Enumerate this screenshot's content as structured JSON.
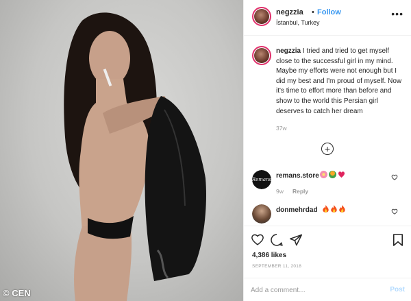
{
  "photo": {
    "credit": "© CEN"
  },
  "post": {
    "username": "negzzia",
    "separator": "•",
    "follow_label": "Follow",
    "location": "İstanbul, Turkey",
    "more_icon": "more-dots-icon"
  },
  "caption": {
    "username": "negzzia",
    "text": "I tried and tried to get myself close to the successful girl in my mind. Maybe my efforts were not enough but I did my best and I'm proud of myself. Now it's time to effort more than before and show to the world this Persian girl deserves to catch her dream",
    "time": "37w"
  },
  "load_more_icon": "plus-circle-icon",
  "comments": [
    {
      "username": "remans.store",
      "avatar_text": "Remans",
      "time": "9w",
      "reply_label": "Reply"
    },
    {
      "username": "donmehrdad"
    }
  ],
  "actions": {
    "likes": "4,386 likes",
    "date": "SEPTEMBER 11, 2018"
  },
  "add_comment": {
    "placeholder": "Add a comment…",
    "post_label": "Post"
  },
  "colors": {
    "accent": "#3897f0",
    "muted": "#999999",
    "text": "#262626",
    "border": "#efefef",
    "post_disabled": "#b3dbff"
  }
}
